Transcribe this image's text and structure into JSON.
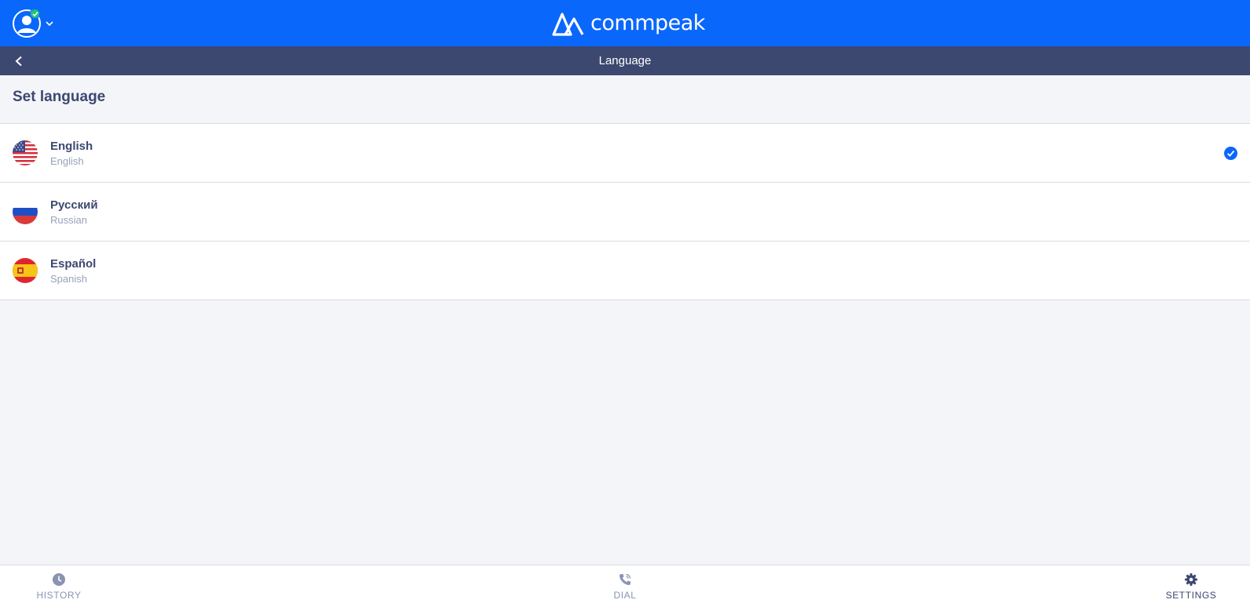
{
  "header": {
    "brand": "commpeak",
    "user_status": "online"
  },
  "subheader": {
    "title": "Language"
  },
  "section": {
    "title": "Set language"
  },
  "languages": [
    {
      "name": "English",
      "sub": "English",
      "flag": "us-flag-icon",
      "selected": true
    },
    {
      "name": "Русский",
      "sub": "Russian",
      "flag": "russia-flag-icon",
      "selected": false
    },
    {
      "name": "Español",
      "sub": "Spanish",
      "flag": "spain-flag-icon",
      "selected": false
    }
  ],
  "bottom_nav": [
    {
      "label": "HISTORY",
      "icon": "clock-icon",
      "active": false
    },
    {
      "label": "DIAL",
      "icon": "phone-icon",
      "active": false
    },
    {
      "label": "SETTINGS",
      "icon": "gear-icon",
      "active": true
    }
  ],
  "colors": {
    "primary": "#0a67fb",
    "subbar": "#3c4870",
    "background": "#f4f5f9",
    "status_online": "#22c27a",
    "muted_text": "#97a2b8"
  }
}
